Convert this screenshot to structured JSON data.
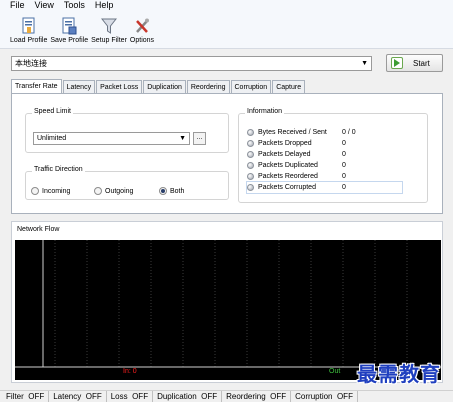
{
  "menu": [
    "File",
    "View",
    "Tools",
    "Help"
  ],
  "toolbar": {
    "buttons": [
      {
        "label": "Load Profile",
        "icon": "load-profile-icon"
      },
      {
        "label": "Save Profile",
        "icon": "save-profile-icon"
      },
      {
        "label": "Setup Filter",
        "icon": "filter-icon"
      },
      {
        "label": "Options",
        "icon": "options-tools-icon"
      }
    ]
  },
  "connection": {
    "selected": "本地连接",
    "start_label": "Start"
  },
  "tabs": [
    "Transfer Rate",
    "Latency",
    "Packet Loss",
    "Duplication",
    "Reordering",
    "Corruption",
    "Capture"
  ],
  "active_tab": "Transfer Rate",
  "speed_limit": {
    "title": "Speed Limit",
    "value": "Unlimited",
    "more_label": "..."
  },
  "traffic_direction": {
    "title": "Traffic Direction",
    "options": [
      "Incoming",
      "Outgoing",
      "Both"
    ],
    "selected": "Both"
  },
  "information": {
    "title": "Information",
    "rows": [
      {
        "label": "Bytes Received / Sent",
        "value": "0 / 0"
      },
      {
        "label": "Packets Dropped",
        "value": "0"
      },
      {
        "label": "Packets Delayed",
        "value": "0"
      },
      {
        "label": "Packets Duplicated",
        "value": "0"
      },
      {
        "label": "Packets Reordered",
        "value": "0"
      },
      {
        "label": "Packets Corrupted",
        "value": "0"
      }
    ]
  },
  "network_flow": {
    "title": "Network Flow",
    "in_label": "In: 0",
    "out_label": "Out"
  },
  "statusbar": [
    {
      "name": "Filter",
      "value": "OFF"
    },
    {
      "name": "Latency",
      "value": "OFF"
    },
    {
      "name": "Loss",
      "value": "OFF"
    },
    {
      "name": "Duplication",
      "value": "OFF"
    },
    {
      "name": "Reordering",
      "value": "OFF"
    },
    {
      "name": "Corruption",
      "value": "OFF"
    }
  ],
  "watermark": "最需教育",
  "colors": {
    "graph_bg": "#000000",
    "in_label": "#ff2020",
    "out_label": "#3ec43e",
    "grid": "#3a3a3a"
  }
}
